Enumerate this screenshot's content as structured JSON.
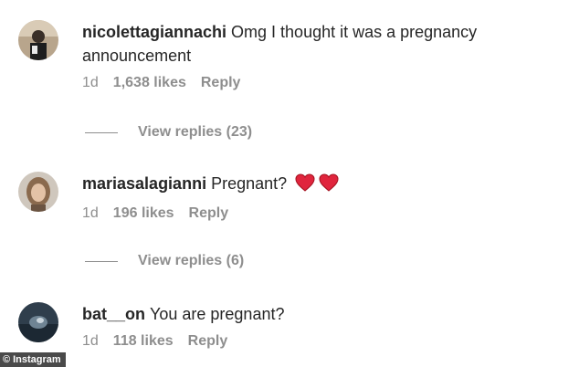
{
  "comments": [
    {
      "username": "nicolettagiannachi",
      "text": "Omg I thought it was a pregnancy announcement",
      "time": "1d",
      "likes": "1,638 likes",
      "reply": "Reply",
      "view_replies": "View replies (23)"
    },
    {
      "username": "mariasalagianni",
      "text": "Pregnant?",
      "emoji": "heart-emoji",
      "time": "1d",
      "likes": "196 likes",
      "reply": "Reply",
      "view_replies": "View replies (6)"
    },
    {
      "username": "bat__on",
      "text": "You are pregnant?",
      "time": "1d",
      "likes": "118 likes",
      "reply": "Reply"
    }
  ],
  "watermark": {
    "symbol": "©",
    "label": "Instagram"
  },
  "colors": {
    "text": "#262626",
    "muted": "#8e8e8e",
    "heart": "#e0253d"
  }
}
